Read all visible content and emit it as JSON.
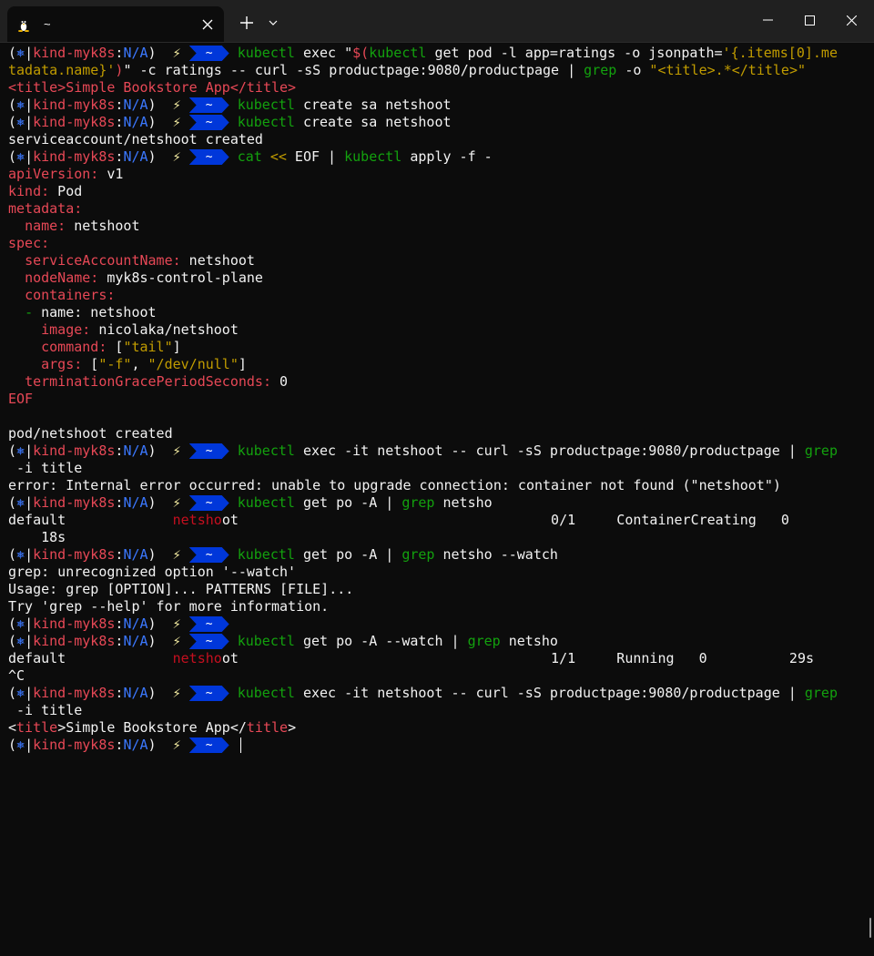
{
  "window": {
    "tab_title": "~",
    "tab_icon": "linux-penguin-icon",
    "new_tab_label": "+",
    "dropdown_label": "⌄",
    "minimize_label": "—",
    "maximize_label": "☐",
    "close_label": "✕",
    "tab_close_label": "✕"
  },
  "prompt": {
    "open": "(",
    "k8s_icon": "⎈",
    "sep": "|",
    "context": "kind-myk8s",
    "colon": ":",
    "namespace": "N/A",
    "close": ")",
    "bolt": "⚡",
    "dir": "~"
  },
  "lines": [
    {
      "prompt": true,
      "segs": [
        [
          "green",
          "kubectl"
        ],
        [
          "white",
          " exec \""
        ],
        [
          "red",
          "$("
        ],
        [
          "green",
          "kubectl"
        ],
        [
          "white",
          " get pod -l app=ratings -o jsonpath="
        ],
        [
          "yellow",
          "'{.items[0].me"
        ]
      ]
    },
    {
      "prompt": false,
      "segs": [
        [
          "yellow",
          "tadata.name}'"
        ],
        [
          "red",
          ")"
        ],
        [
          "white",
          "\" -c ratings -- curl -sS productpage:9080/productpage | "
        ],
        [
          "green",
          "grep"
        ],
        [
          "white",
          " -o "
        ],
        [
          "yellow",
          "\"<title>.*</title>\""
        ]
      ]
    },
    {
      "prompt": false,
      "segs": [
        [
          "red",
          "<title>"
        ],
        [
          "red",
          "Simple Bookstore App"
        ],
        [
          "red",
          "</title>"
        ]
      ]
    },
    {
      "prompt": true,
      "segs": [
        [
          "green",
          "kubectl"
        ],
        [
          "white",
          " create sa netshoot"
        ]
      ]
    },
    {
      "prompt": true,
      "segs": [
        [
          "green",
          "kubectl"
        ],
        [
          "white",
          " create sa netshoot"
        ]
      ]
    },
    {
      "prompt": false,
      "segs": [
        [
          "white",
          "serviceaccount/netshoot created"
        ]
      ]
    },
    {
      "prompt": true,
      "segs": [
        [
          "green",
          "cat"
        ],
        [
          "white",
          " "
        ],
        [
          "yellow",
          "<<"
        ],
        [
          "white",
          " EOF | "
        ],
        [
          "green",
          "kubectl"
        ],
        [
          "white",
          " apply -f -"
        ]
      ]
    },
    {
      "prompt": false,
      "segs": [
        [
          "red",
          "apiVersion:"
        ],
        [
          "white",
          " v1"
        ]
      ]
    },
    {
      "prompt": false,
      "segs": [
        [
          "red",
          "kind:"
        ],
        [
          "white",
          " Pod"
        ]
      ]
    },
    {
      "prompt": false,
      "segs": [
        [
          "red",
          "metadata:"
        ]
      ]
    },
    {
      "prompt": false,
      "segs": [
        [
          "white",
          "  "
        ],
        [
          "red",
          "name:"
        ],
        [
          "white",
          " netshoot"
        ]
      ]
    },
    {
      "prompt": false,
      "segs": [
        [
          "red",
          "spec:"
        ]
      ]
    },
    {
      "prompt": false,
      "segs": [
        [
          "white",
          "  "
        ],
        [
          "red",
          "serviceAccountName:"
        ],
        [
          "white",
          " netshoot"
        ]
      ]
    },
    {
      "prompt": false,
      "segs": [
        [
          "white",
          "  "
        ],
        [
          "red",
          "nodeName:"
        ],
        [
          "white",
          " myk8s-control-plane"
        ]
      ]
    },
    {
      "prompt": false,
      "segs": [
        [
          "white",
          "  "
        ],
        [
          "red",
          "containers:"
        ]
      ]
    },
    {
      "prompt": false,
      "segs": [
        [
          "white",
          "  "
        ],
        [
          "green",
          "-"
        ],
        [
          "white",
          " name: netshoot"
        ]
      ]
    },
    {
      "prompt": false,
      "segs": [
        [
          "white",
          "    "
        ],
        [
          "red",
          "image:"
        ],
        [
          "white",
          " nicolaka/netshoot"
        ]
      ]
    },
    {
      "prompt": false,
      "segs": [
        [
          "white",
          "    "
        ],
        [
          "red",
          "command:"
        ],
        [
          "white",
          " ["
        ],
        [
          "yellow",
          "\"tail\""
        ],
        [
          "white",
          "]"
        ]
      ]
    },
    {
      "prompt": false,
      "segs": [
        [
          "white",
          "    "
        ],
        [
          "red",
          "args:"
        ],
        [
          "white",
          " ["
        ],
        [
          "yellow",
          "\"-f\""
        ],
        [
          "white",
          ", "
        ],
        [
          "yellow",
          "\"/dev/null\""
        ],
        [
          "white",
          "]"
        ]
      ]
    },
    {
      "prompt": false,
      "segs": [
        [
          "white",
          "  "
        ],
        [
          "red",
          "terminationGracePeriodSeconds:"
        ],
        [
          "white",
          " 0"
        ]
      ]
    },
    {
      "prompt": false,
      "segs": [
        [
          "red",
          "EOF"
        ]
      ]
    },
    {
      "prompt": false,
      "segs": [
        [
          "white",
          ""
        ]
      ]
    },
    {
      "prompt": false,
      "segs": [
        [
          "white",
          "pod/netshoot created"
        ]
      ]
    },
    {
      "prompt": true,
      "segs": [
        [
          "green",
          "kubectl"
        ],
        [
          "white",
          " exec -it netshoot -- curl -sS productpage:9080/productpage | "
        ],
        [
          "green",
          "grep"
        ]
      ]
    },
    {
      "prompt": false,
      "segs": [
        [
          "white",
          " -i title"
        ]
      ]
    },
    {
      "prompt": false,
      "segs": [
        [
          "white",
          "error: Internal error occurred: unable to upgrade connection: container not found (\"netshoot\")"
        ]
      ]
    },
    {
      "prompt": true,
      "segs": [
        [
          "green",
          "kubectl"
        ],
        [
          "white",
          " get po -A | "
        ],
        [
          "green",
          "grep"
        ],
        [
          "white",
          " netsho"
        ]
      ]
    },
    {
      "prompt": false,
      "segs": [
        [
          "white",
          "default             "
        ],
        [
          "bright-red",
          "netsho"
        ],
        [
          "white",
          "ot                                      0/1     ContainerCreating   0"
        ]
      ]
    },
    {
      "prompt": false,
      "segs": [
        [
          "white",
          "    18s"
        ]
      ]
    },
    {
      "prompt": true,
      "segs": [
        [
          "green",
          "kubectl"
        ],
        [
          "white",
          " get po -A | "
        ],
        [
          "green",
          "grep"
        ],
        [
          "white",
          " netsho --watch"
        ]
      ]
    },
    {
      "prompt": false,
      "segs": [
        [
          "white",
          "grep: unrecognized option '--watch'"
        ]
      ]
    },
    {
      "prompt": false,
      "segs": [
        [
          "white",
          "Usage: grep [OPTION]... PATTERNS [FILE]..."
        ]
      ]
    },
    {
      "prompt": false,
      "segs": [
        [
          "white",
          "Try 'grep --help' for more information."
        ]
      ]
    },
    {
      "prompt": true,
      "segs": []
    },
    {
      "prompt": true,
      "segs": [
        [
          "green",
          "kubectl"
        ],
        [
          "white",
          " get po -A --watch | "
        ],
        [
          "green",
          "grep"
        ],
        [
          "white",
          " netsho"
        ]
      ]
    },
    {
      "prompt": false,
      "segs": [
        [
          "white",
          "default             "
        ],
        [
          "bright-red",
          "netsho"
        ],
        [
          "white",
          "ot                                      1/1     Running   0          29s"
        ]
      ]
    },
    {
      "prompt": false,
      "segs": [
        [
          "white",
          "^C"
        ]
      ]
    },
    {
      "prompt": true,
      "segs": [
        [
          "green",
          "kubectl"
        ],
        [
          "white",
          " exec -it netshoot -- curl -sS productpage:9080/productpage | "
        ],
        [
          "green",
          "grep"
        ]
      ]
    },
    {
      "prompt": false,
      "segs": [
        [
          "white",
          " -i title"
        ]
      ]
    },
    {
      "prompt": false,
      "segs": [
        [
          "white",
          "<"
        ],
        [
          "red",
          "title"
        ],
        [
          "white",
          ">Simple Bookstore App</"
        ],
        [
          "red",
          "title"
        ],
        [
          "white",
          ">"
        ]
      ]
    },
    {
      "prompt": true,
      "segs": [],
      "cursor": true
    }
  ]
}
